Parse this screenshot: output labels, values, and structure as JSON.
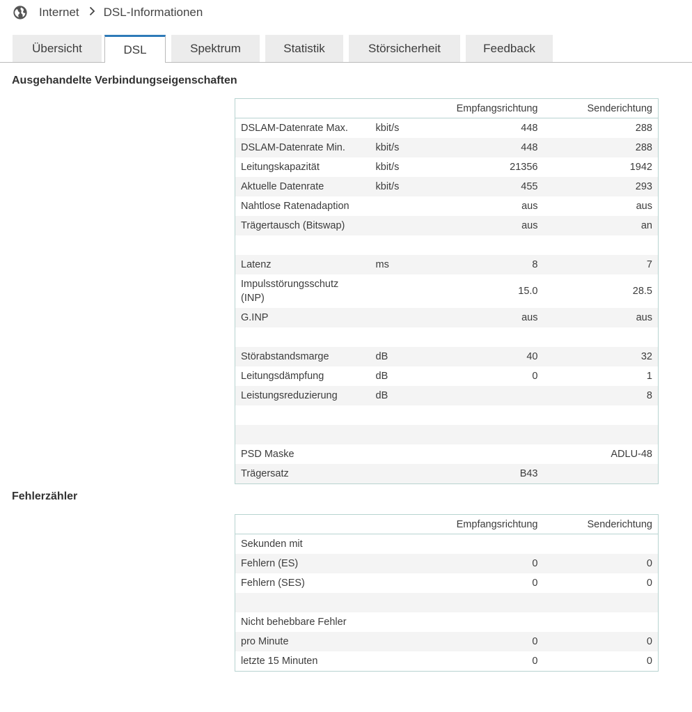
{
  "breadcrumb": {
    "root": "Internet",
    "current": "DSL-Informationen",
    "icon": "globe-icon"
  },
  "tabs": [
    {
      "label": "Übersicht",
      "active": false
    },
    {
      "label": "DSL",
      "active": true
    },
    {
      "label": "Spektrum",
      "active": false
    },
    {
      "label": "Statistik",
      "active": false
    },
    {
      "label": "Störsicherheit",
      "active": false
    },
    {
      "label": "Feedback",
      "active": false
    }
  ],
  "connection": {
    "title": "Ausgehandelte Verbindungseigenschaften",
    "headers": {
      "down": "Empfangsrichtung",
      "up": "Senderichtung"
    },
    "rows": [
      {
        "label": "DSLAM-Datenrate Max.",
        "unit": "kbit/s",
        "down": "448",
        "up": "288"
      },
      {
        "label": "DSLAM-Datenrate Min.",
        "unit": "kbit/s",
        "down": "448",
        "up": "288"
      },
      {
        "label": "Leitungskapazität",
        "unit": "kbit/s",
        "down": "21356",
        "up": "1942"
      },
      {
        "label": "Aktuelle Datenrate",
        "unit": "kbit/s",
        "down": "455",
        "up": "293"
      },
      {
        "label": "Nahtlose Ratenadaption",
        "unit": "",
        "down": "aus",
        "up": "aus"
      },
      {
        "label": "Trägertausch (Bitswap)",
        "unit": "",
        "down": "aus",
        "up": "an"
      },
      {
        "label": "",
        "unit": "",
        "down": "",
        "up": ""
      },
      {
        "label": "Latenz",
        "unit": "ms",
        "down": "8",
        "up": "7"
      },
      {
        "label": "Impulsstörungsschutz (INP)",
        "unit": "",
        "down": "15.0",
        "up": "28.5"
      },
      {
        "label": "G.INP",
        "unit": "",
        "down": "aus",
        "up": "aus"
      },
      {
        "label": "",
        "unit": "",
        "down": "",
        "up": ""
      },
      {
        "label": "Störabstandsmarge",
        "unit": "dB",
        "down": "40",
        "up": "32"
      },
      {
        "label": "Leitungsdämpfung",
        "unit": "dB",
        "down": "0",
        "up": "1"
      },
      {
        "label": "Leistungsreduzierung",
        "unit": "dB",
        "down": "",
        "up": "8"
      },
      {
        "label": "",
        "unit": "",
        "down": "",
        "up": ""
      },
      {
        "label": "",
        "unit": "",
        "down": "",
        "up": ""
      },
      {
        "label": "PSD Maske",
        "unit": "",
        "down": "",
        "up": "ADLU-48"
      },
      {
        "label": "Trägersatz",
        "unit": "",
        "down": "B43",
        "up": ""
      }
    ]
  },
  "errors": {
    "title": "Fehlerzähler",
    "headers": {
      "down": "Empfangsrichtung",
      "up": "Senderichtung"
    },
    "rows": [
      {
        "label": "Sekunden mit",
        "unit": "",
        "down": "",
        "up": ""
      },
      {
        "label": "Fehlern (ES)",
        "unit": "",
        "down": "0",
        "up": "0"
      },
      {
        "label": "Fehlern (SES)",
        "unit": "",
        "down": "0",
        "up": "0"
      },
      {
        "label": "",
        "unit": "",
        "down": "",
        "up": ""
      },
      {
        "label": "Nicht behebbare Fehler",
        "unit": "",
        "down": "",
        "up": ""
      },
      {
        "label": "pro Minute",
        "unit": "",
        "down": "0",
        "up": "0"
      },
      {
        "label": "letzte 15 Minuten",
        "unit": "",
        "down": "0",
        "up": "0"
      }
    ]
  },
  "colors": {
    "accent": "#2d7ab8",
    "border": "#b7d3d0",
    "stripe": "#f4f4f4",
    "tab_bg": "#ececec"
  }
}
